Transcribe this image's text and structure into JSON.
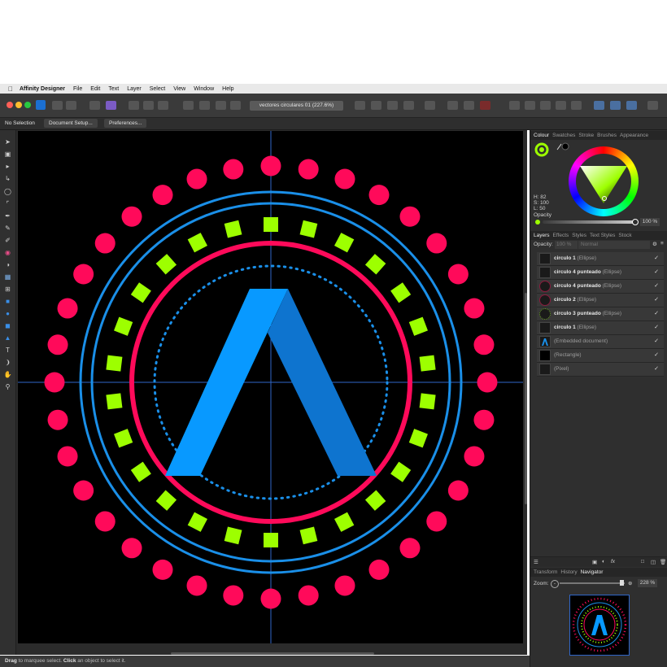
{
  "menubar": {
    "app_name": "Affinity Designer",
    "items": [
      "File",
      "Edit",
      "Text",
      "Layer",
      "Select",
      "View",
      "Window",
      "Help"
    ]
  },
  "toolbar": {
    "document_title": "vectores circulares 01 (227.6%)"
  },
  "context": {
    "selection": "No Selection",
    "document_setup": "Document Setup...",
    "preferences": "Preferences..."
  },
  "colour_panel": {
    "tabs": [
      "Colour",
      "Swatches",
      "Stroke",
      "Brushes",
      "Appearance"
    ],
    "h_label": "H: 82",
    "s_label": "S: 100",
    "l_label": "L: 50",
    "opacity_label": "Opacity",
    "opacity_value": "100 %",
    "fill_color": "#9dff00"
  },
  "layers_panel": {
    "tabs": [
      "Layers",
      "Effects",
      "Styles",
      "Text Styles",
      "Stock"
    ],
    "opacity_label": "Opacity:",
    "opacity_value": "100 %",
    "blend_mode": "Normal",
    "rows": [
      {
        "name": "circulo 1",
        "type": "(Ellipse)",
        "check": "✓"
      },
      {
        "name": "circulo 4 punteado",
        "type": "(Ellipse)",
        "check": "✓"
      },
      {
        "name": "circulo 4 punteado",
        "type": "(Ellipse)",
        "check": "✓"
      },
      {
        "name": "circulo 2",
        "type": "(Ellipse)",
        "check": "✓"
      },
      {
        "name": "circulo 3 punteado",
        "type": "(Ellipse)",
        "check": "✓"
      },
      {
        "name": "circulo 1",
        "type": "(Ellipse)",
        "check": "✓"
      },
      {
        "name": "",
        "type": "(Embedded document)",
        "check": "✓"
      },
      {
        "name": "",
        "type": "(Rectangle)",
        "check": "✓"
      },
      {
        "name": "",
        "type": "(Pixel)",
        "check": "✓"
      }
    ]
  },
  "navigator_panel": {
    "tabs": [
      "Transform",
      "History",
      "Navigator"
    ],
    "zoom_label": "Zoom:",
    "zoom_value": "228 %"
  },
  "statusbar": {
    "drag": "Drag",
    "text1": " to marquee select. ",
    "click": "Click",
    "text2": " an object to select it."
  },
  "artwork_colors": {
    "pink": "#ff0a5a",
    "blue": "#1a8fe8",
    "green": "#9dff00",
    "logo_light": "#0899ff",
    "logo_dark": "#0e74cf"
  }
}
